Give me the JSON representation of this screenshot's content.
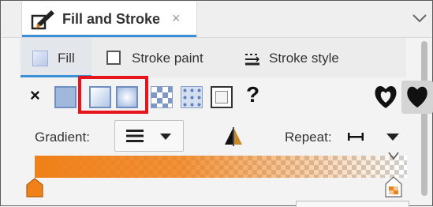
{
  "panel": {
    "title": "Fill and Stroke",
    "close_glyph": "×",
    "icon": "fill-stroke-brush-icon",
    "menu_icon": "chevron-down-icon"
  },
  "subtabs": [
    {
      "label": "Fill",
      "icon": "fill-square-icon",
      "active": true
    },
    {
      "label": "Stroke paint",
      "icon": "stroke-square-icon",
      "active": false
    },
    {
      "label": "Stroke style",
      "icon": "stroke-style-icon",
      "active": false
    }
  ],
  "paint_types": {
    "no_paint_glyph": "×",
    "unset_glyph": "?",
    "items": [
      "no-paint",
      "flat-color",
      "linear-gradient",
      "radial-gradient",
      "mesh-gradient",
      "pattern",
      "swatch",
      "unset"
    ],
    "highlighted": [
      "linear-gradient",
      "radial-gradient"
    ],
    "highlight_color": "#e8141c"
  },
  "fill_rules": [
    "evenodd",
    "nonzero"
  ],
  "gradient": {
    "label": "Gradient:",
    "repeat_label": "Repeat:",
    "color": "#f08018"
  },
  "colors": {
    "accent": "#3b8fd9"
  }
}
